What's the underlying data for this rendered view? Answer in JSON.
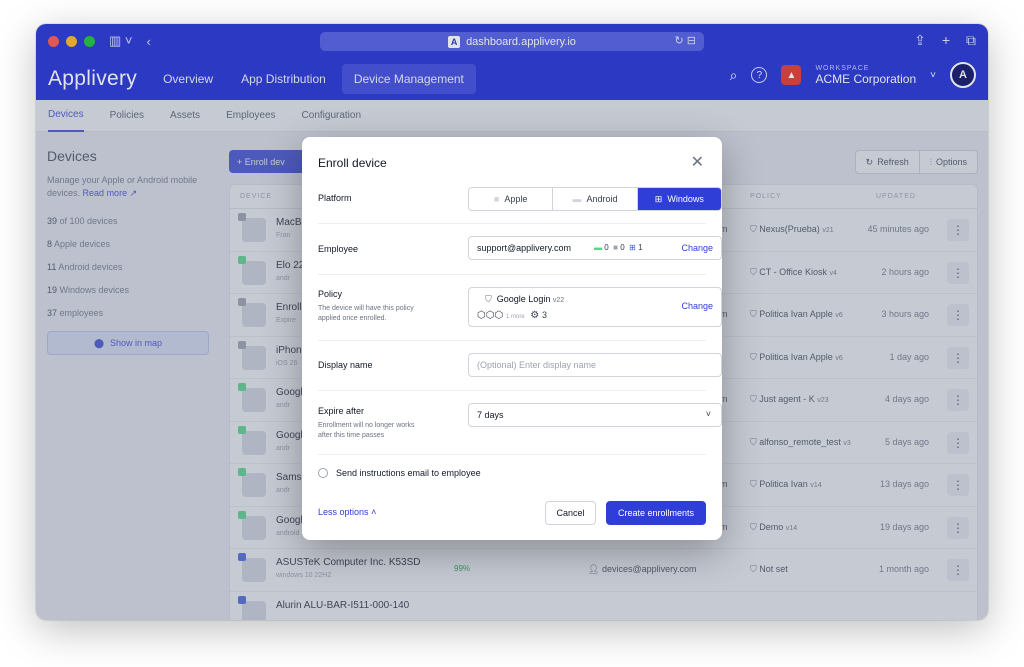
{
  "browser": {
    "url": "dashboard.applivery.io"
  },
  "navbar": {
    "brand": "Applivery",
    "items": [
      {
        "label": "Overview"
      },
      {
        "label": "App Distribution"
      },
      {
        "label": "Device Management"
      }
    ],
    "workspace_label": "WORKSPACE",
    "workspace_name": "ACME Corporation"
  },
  "subnav": {
    "items": [
      {
        "label": "Devices"
      },
      {
        "label": "Policies"
      },
      {
        "label": "Assets"
      },
      {
        "label": "Employees"
      },
      {
        "label": "Configuration"
      }
    ]
  },
  "sidebar": {
    "title": "Devices",
    "description": "Manage your Apple or Android mobile devices.",
    "read_more": "Read more",
    "stats": [
      {
        "strong": "39",
        "rest": " of 100 devices"
      },
      {
        "strong": "8",
        "rest": " Apple devices"
      },
      {
        "strong": "11",
        "rest": " Android devices"
      },
      {
        "strong": "19",
        "rest": " Windows devices"
      },
      {
        "strong": "37",
        "rest": " employees"
      }
    ],
    "map_button": "Show in map"
  },
  "toolbar": {
    "enroll": "+ Enroll dev",
    "refresh": "Refresh",
    "options": "Options"
  },
  "table": {
    "headers": {
      "device": "DEVICE",
      "policy": "POLICY",
      "updated": "UPDATED"
    },
    "rows": [
      {
        "name": "MacBo",
        "sub": "Fran",
        "policy": "Nexus(Prueba)",
        "ver": "v21",
        "updated": "45 minutes ago",
        "m": "m"
      },
      {
        "name": "Elo 22",
        "sub": "andr",
        "policy": "CT - Office Kiosk",
        "ver": "v4",
        "updated": "2 hours ago",
        "m": ""
      },
      {
        "name": "Enroll",
        "sub": "Expire",
        "policy": "Politica Ivan Apple",
        "ver": "v6",
        "updated": "3 hours ago",
        "m": "m"
      },
      {
        "name": "iPhone",
        "sub": "iOS 26",
        "policy": "Politica Ivan Apple",
        "ver": "v6",
        "updated": "1 day ago",
        "m": ""
      },
      {
        "name": "Googl",
        "sub": "andr",
        "policy": "Just agent - K",
        "ver": "v23",
        "updated": "4 days ago",
        "m": "m"
      },
      {
        "name": "Googl",
        "sub": "andr",
        "policy": "alfonso_remote_test",
        "ver": "v3",
        "updated": "5 days ago",
        "m": ""
      },
      {
        "name": "Samsu",
        "sub": "andr",
        "policy": "Politica Ivan",
        "ver": "v14",
        "updated": "13 days ago",
        "m": "m"
      },
      {
        "name": "Googl",
        "sub": "android 15 • Google Pixel 9",
        "policy": "Demo",
        "ver": "v14",
        "updated": "19 days ago",
        "m": "m"
      },
      {
        "name": "ASUSTeK Computer Inc. K53SD",
        "sub": "windows 10 22H2",
        "battery": "99%",
        "employee": "devices@applivery.com",
        "policy": "Not set",
        "ver": "",
        "updated": "1 month ago",
        "m": ""
      },
      {
        "name": "Alurin ALU-BAR-I511-000-140",
        "sub": "",
        "policy": "",
        "ver": "",
        "updated": "",
        "m": ""
      }
    ]
  },
  "modal": {
    "title": "Enroll device",
    "platform_label": "Platform",
    "platforms": [
      {
        "label": "Apple"
      },
      {
        "label": "Android"
      },
      {
        "label": "Windows"
      }
    ],
    "employee_label": "Employee",
    "employee_value": "support@applivery.com",
    "employee_counts": [
      "0",
      "0",
      "1"
    ],
    "change": "Change",
    "policy_label": "Policy",
    "policy_help": "The device will have this policy applied once enrolled.",
    "policy_name": "Google Login",
    "policy_version": "v22",
    "policy_more": "1 more",
    "policy_count": "3",
    "display_name_label": "Display name",
    "display_name_placeholder": "(Optional) Enter display name",
    "expire_label": "Expire after",
    "expire_help": "Enrollment will no longer works after this time passes",
    "expire_value": "7 days",
    "send_email": "Send instructions email to employee",
    "less_options": "Less options",
    "cancel": "Cancel",
    "create": "Create enrollments"
  },
  "colors": {
    "brand": "#2f3ed6",
    "apple_badge": "#9ca3af",
    "android_badge": "#4ade80",
    "windows_badge": "#3b5bdb"
  }
}
